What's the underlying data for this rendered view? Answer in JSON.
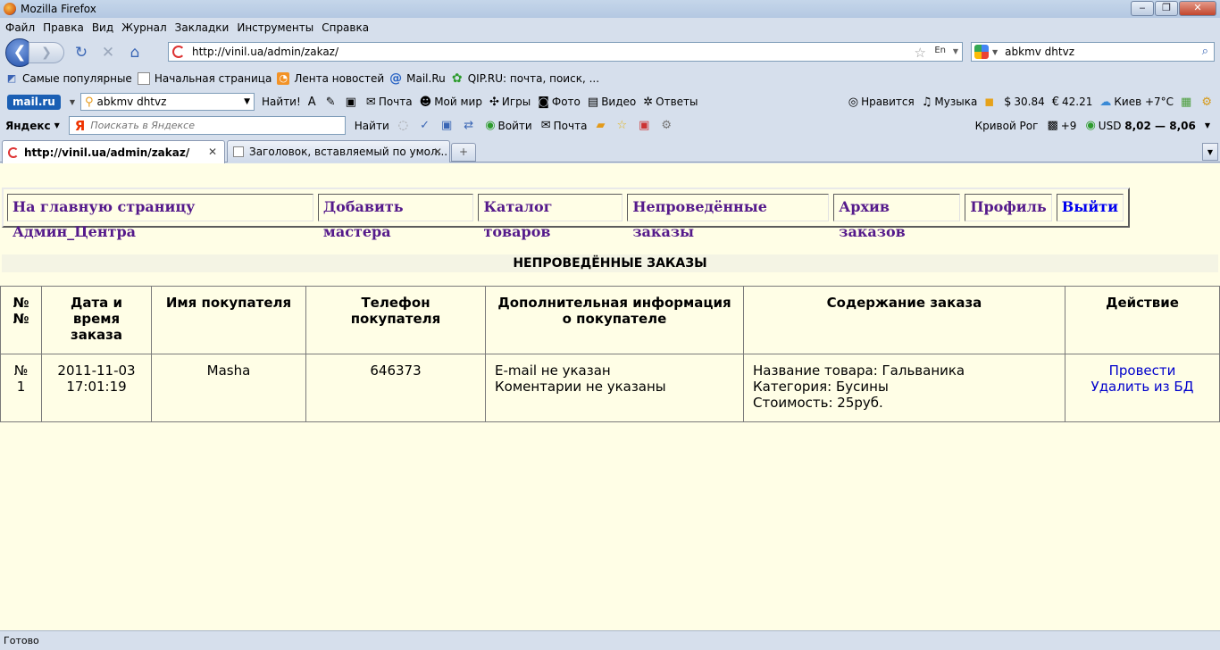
{
  "window": {
    "title": "Mozilla Firefox",
    "min": "‒",
    "max": "❐",
    "close": "✕"
  },
  "menu": [
    "Файл",
    "Правка",
    "Вид",
    "Журнал",
    "Закладки",
    "Инструменты",
    "Справка"
  ],
  "nav": {
    "url": "http://vinil.ua/admin/zakaz/",
    "lang": "En",
    "search_value": "abkmv dhtvz"
  },
  "bookmarks": [
    "Самые популярные",
    "Начальная страница",
    "Лента новостей",
    "Mail.Ru",
    "QIP.RU: почта, поиск, ..."
  ],
  "mailru": {
    "logo": "mail.ru",
    "search_value": "abkmv dhtvz",
    "find": "Найти!",
    "items": [
      "Почта",
      "Мой мир",
      "Игры",
      "Фото",
      "Видео",
      "Ответы"
    ],
    "right": {
      "like": "Нравится",
      "music": "Музыка",
      "usd": "30.84",
      "eur": "42.21",
      "weather": "Киев +7°C"
    }
  },
  "yandex": {
    "logo": "Яндекс",
    "placeholder": "Поискать в Яндексе",
    "find": "Найти",
    "login": "Войти",
    "mail": "Почта",
    "city": "Кривой Рог",
    "temp": "+9",
    "usd_label": "USD",
    "usd_rate": "8,02 — 8,06"
  },
  "tabs": [
    {
      "label": "http://vinil.ua/admin/zakaz/",
      "active": true
    },
    {
      "label": "Заголовок, вставляемый по умол...",
      "active": false
    }
  ],
  "admin_nav": [
    "На главную страницу Админ_Центра",
    "Добавить мастера",
    "Каталог товаров",
    "Непроведённые заказы",
    "Архив заказов",
    "Профиль",
    "Выйти"
  ],
  "heading": "НЕПРОВЕДЁННЫЕ ЗАКАЗЫ",
  "table": {
    "headers": [
      "№ №",
      "Дата и время заказа",
      "Имя покупателя",
      "Телефон покупателя",
      "Дополнительная информация о покупателе",
      "Содержание заказа",
      "Действие"
    ],
    "rows": [
      {
        "num": "№ 1",
        "datetime": "2011-11-03 17:01:19",
        "name": "Masha",
        "phone": "646373",
        "info_email": "E-mail не указан",
        "info_comments": "Коментарии не указаны",
        "item_name": "Название товара: Гальваника",
        "item_category": "Категория: Бусины",
        "item_price": "Стоимость: 25руб.",
        "action_conduct": "Провести",
        "action_delete": "Удалить из БД"
      }
    ]
  },
  "status": "Готово"
}
